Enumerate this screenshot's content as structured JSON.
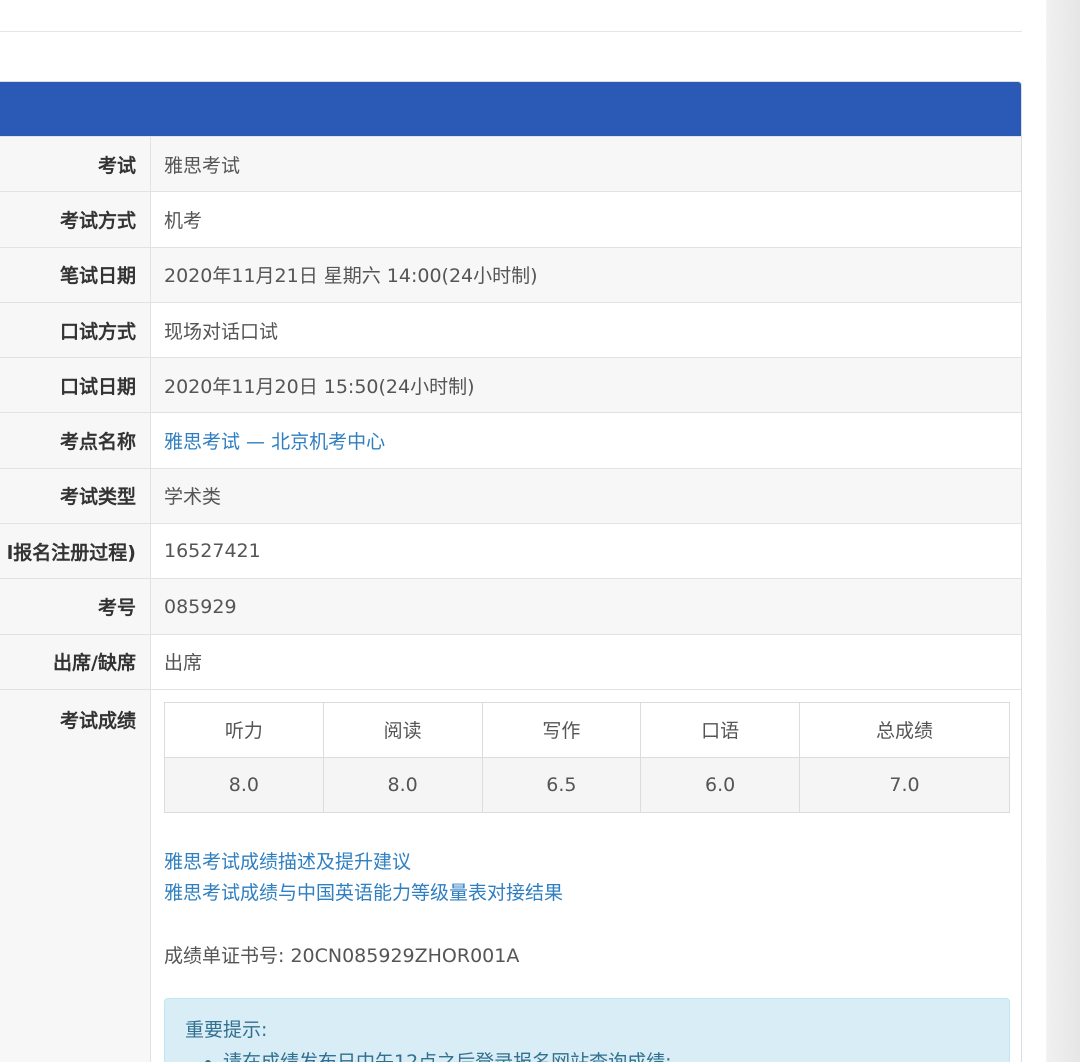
{
  "rows": [
    {
      "label": "考试",
      "value": "雅思考试"
    },
    {
      "label": "考试方式",
      "value": "机考"
    },
    {
      "label": "笔试日期",
      "value": "2020年11月21日 星期六 14:00(24小时制)"
    },
    {
      "label": "口试方式",
      "value": "现场对话口试"
    },
    {
      "label": "口试日期",
      "value": "2020年11月20日 15:50(24小时制)"
    },
    {
      "label": "考点名称",
      "value": "雅思考试 — 北京机考中心"
    },
    {
      "label": "考试类型",
      "value": "学术类"
    },
    {
      "label": "l报名注册过程)",
      "value": "16527421"
    },
    {
      "label": "考号",
      "value": "085929"
    },
    {
      "label": "出席/缺席",
      "value": "出席"
    }
  ],
  "scores": {
    "label": "考试成绩",
    "headers": [
      "听力",
      "阅读",
      "写作",
      "口语",
      "总成绩"
    ],
    "values": [
      "8.0",
      "8.0",
      "6.5",
      "6.0",
      "7.0"
    ]
  },
  "links": [
    "雅思考试成绩描述及提升建议",
    "雅思考试成绩与中国英语能力等级量表对接结果"
  ],
  "certificate": "成绩单证书号: 20CN085929ZHOR001A",
  "notice": {
    "title": "重要提示:",
    "items": [
      "请在成绩发布日中午12点之后登录报名网站查询成绩;"
    ]
  },
  "colors": {
    "header": "#2a5ab6",
    "link": "#2f7fc1",
    "notice_bg": "#d9edf7"
  }
}
